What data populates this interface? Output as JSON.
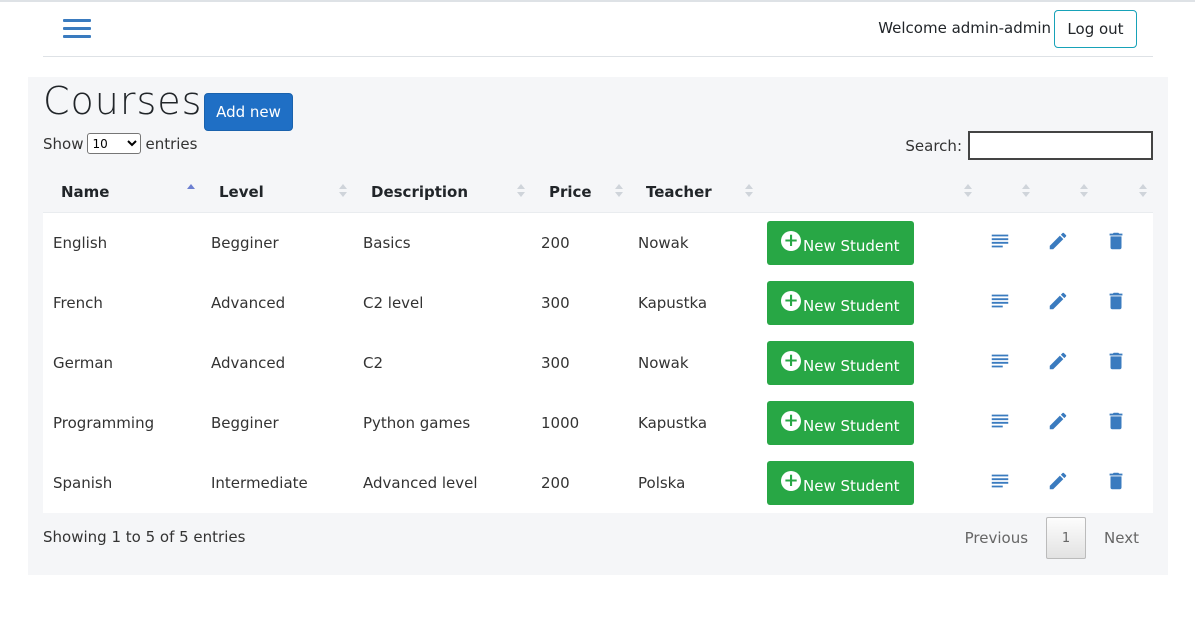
{
  "header": {
    "welcome": "Welcome admin-admin",
    "logout": "Log out"
  },
  "page": {
    "title": "Courses",
    "add_new": "Add new",
    "show_label": "Show",
    "entries_label": "entries",
    "entries_value": "10",
    "search_label": "Search:"
  },
  "table": {
    "columns": [
      "Name",
      "Level",
      "Description",
      "Price",
      "Teacher"
    ],
    "sorted_column": "Name",
    "action_label": "New Student",
    "rows": [
      {
        "name": "English",
        "level": "Begginer",
        "description": "Basics",
        "price": "200",
        "teacher": "Nowak"
      },
      {
        "name": "French",
        "level": "Advanced",
        "description": "C2 level",
        "price": "300",
        "teacher": "Kapustka"
      },
      {
        "name": "German",
        "level": "Advanced",
        "description": "C2",
        "price": "300",
        "teacher": "Nowak"
      },
      {
        "name": "Programming",
        "level": "Begginer",
        "description": "Python games",
        "price": "1000",
        "teacher": "Kapustka"
      },
      {
        "name": "Spanish",
        "level": "Intermediate",
        "description": "Advanced level",
        "price": "200",
        "teacher": "Polska"
      }
    ],
    "row_icons": [
      "details-icon",
      "edit-icon",
      "delete-icon"
    ]
  },
  "footer": {
    "info": "Showing 1 to 5 of 5 entries",
    "previous": "Previous",
    "current_page": "1",
    "next": "Next"
  },
  "colors": {
    "primary": "#1f6fc5",
    "success": "#28a745",
    "icon": "#3a7bbf",
    "panel": "#f5f6f8"
  }
}
